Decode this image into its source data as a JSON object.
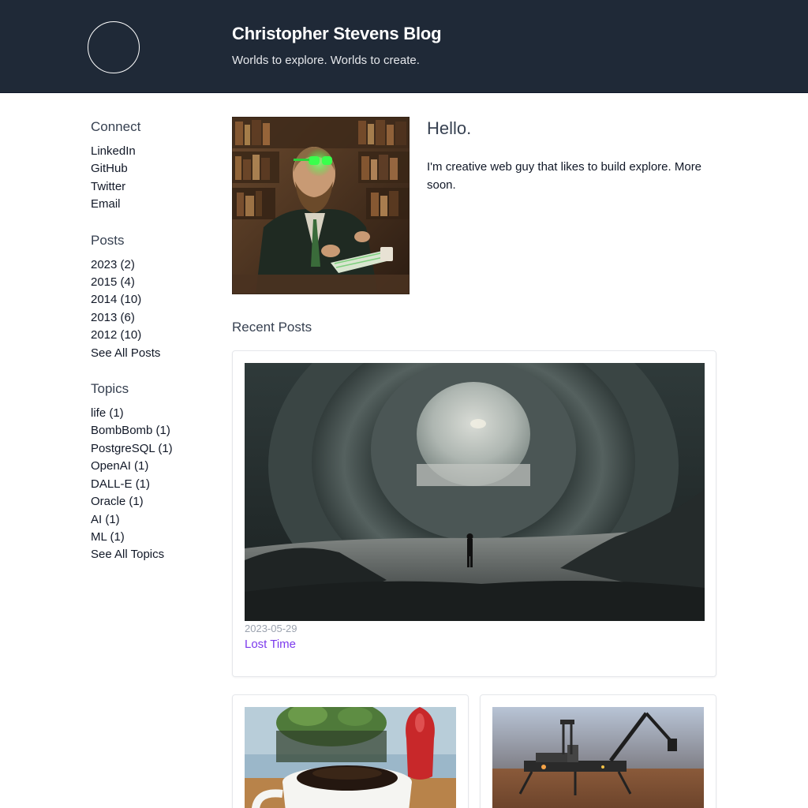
{
  "header": {
    "title": "Christopher Stevens Blog",
    "tagline": "Worlds to explore. Worlds to create."
  },
  "sidebar": {
    "connect": {
      "heading": "Connect",
      "items": [
        "LinkedIn",
        "GitHub",
        "Twitter",
        "Email"
      ]
    },
    "posts": {
      "heading": "Posts",
      "items": [
        "2023 (2)",
        "2015 (4)",
        "2014 (10)",
        "2013 (6)",
        "2012 (10)",
        "See All Posts"
      ]
    },
    "topics": {
      "heading": "Topics",
      "items": [
        "life (1)",
        "BombBomb (1)",
        "PostgreSQL (1)",
        "OpenAI (1)",
        "DALL-E (1)",
        "Oracle (1)",
        "AI (1)",
        "ML (1)",
        "See All Topics"
      ]
    }
  },
  "intro": {
    "heading": "Hello.",
    "text": "I'm creative web guy that likes to build explore. More soon."
  },
  "recent": {
    "heading": "Recent Posts",
    "featured": {
      "date": "2023-05-29",
      "title": "Lost Time"
    }
  },
  "colors": {
    "header_bg": "#1f2937",
    "link_accent": "#7c3aed",
    "heading_text": "#374151"
  }
}
